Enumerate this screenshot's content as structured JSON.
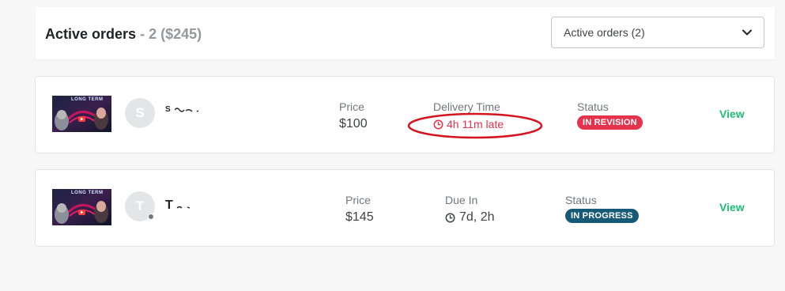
{
  "header": {
    "title": "Active orders",
    "count": "- 2 ($245)",
    "filter_value": "Active orders (2)"
  },
  "orders": [
    {
      "avatar_letter": "S",
      "buyer_name": "S",
      "price_label": "Price",
      "price": "$100",
      "time_label": "Delivery Time",
      "time_value": "4h 11m late",
      "status_label": "Status",
      "status": "IN REVISION",
      "status_color": "#e5334e",
      "action": "View"
    },
    {
      "avatar_letter": "T",
      "buyer_name": "T",
      "price_label": "Price",
      "price": "$145",
      "time_label": "Due In",
      "time_value": "7d, 2h",
      "status_label": "Status",
      "status": "IN PROGRESS",
      "status_color": "#175a77",
      "action": "View"
    }
  ],
  "thumbnail": {
    "title": "LONG TERM"
  },
  "colors": {
    "accent_green": "#1dbf73",
    "late_red": "#e5334e",
    "annotation_red": "#d41521"
  }
}
